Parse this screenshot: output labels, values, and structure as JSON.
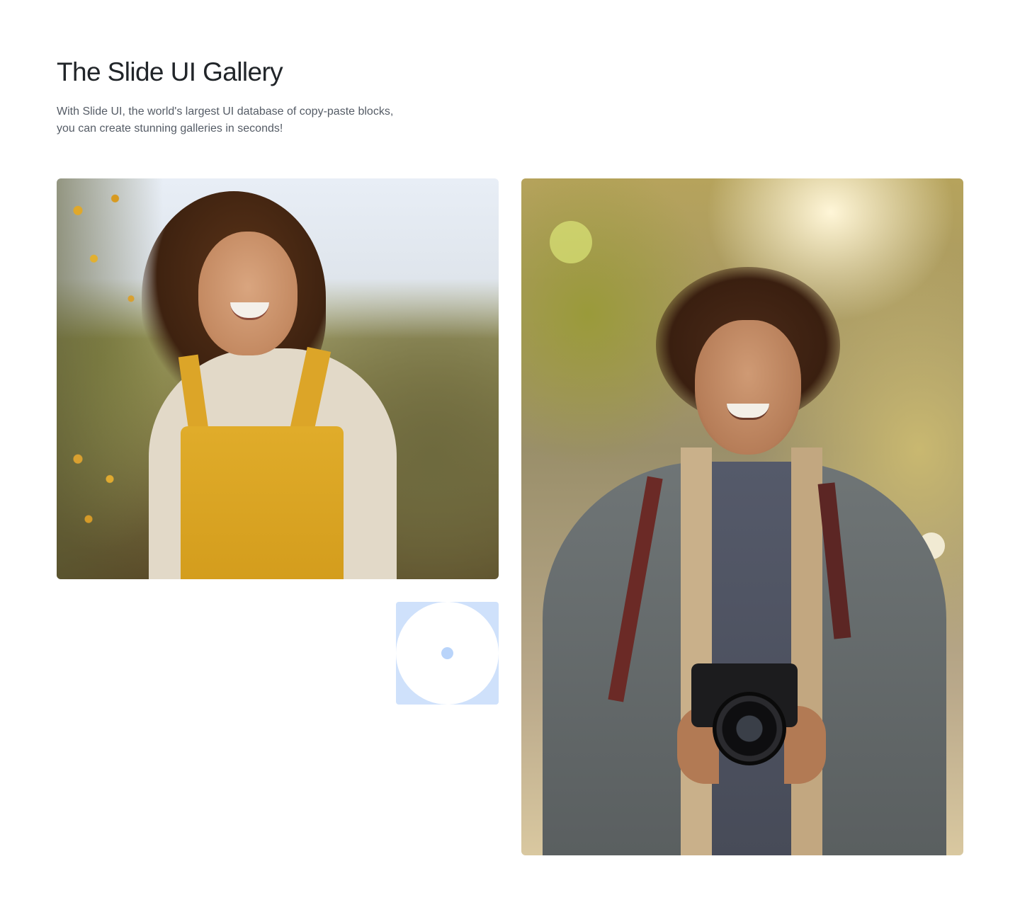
{
  "header": {
    "title": "The Slide UI Gallery",
    "subtitle": "With Slide UI, the world's largest UI database of copy-paste blocks, you can create stunning galleries in seconds!"
  },
  "gallery": {
    "items": [
      {
        "icon": "photo-woman-overalls"
      },
      {
        "icon": "image-placeholder-icon"
      },
      {
        "icon": "photo-man-camera"
      }
    ]
  },
  "colors": {
    "title": "#212529",
    "subtitle": "#555c66",
    "placeholder_tile": "#cfe1fb",
    "placeholder_dot": "#b9d4fa"
  }
}
